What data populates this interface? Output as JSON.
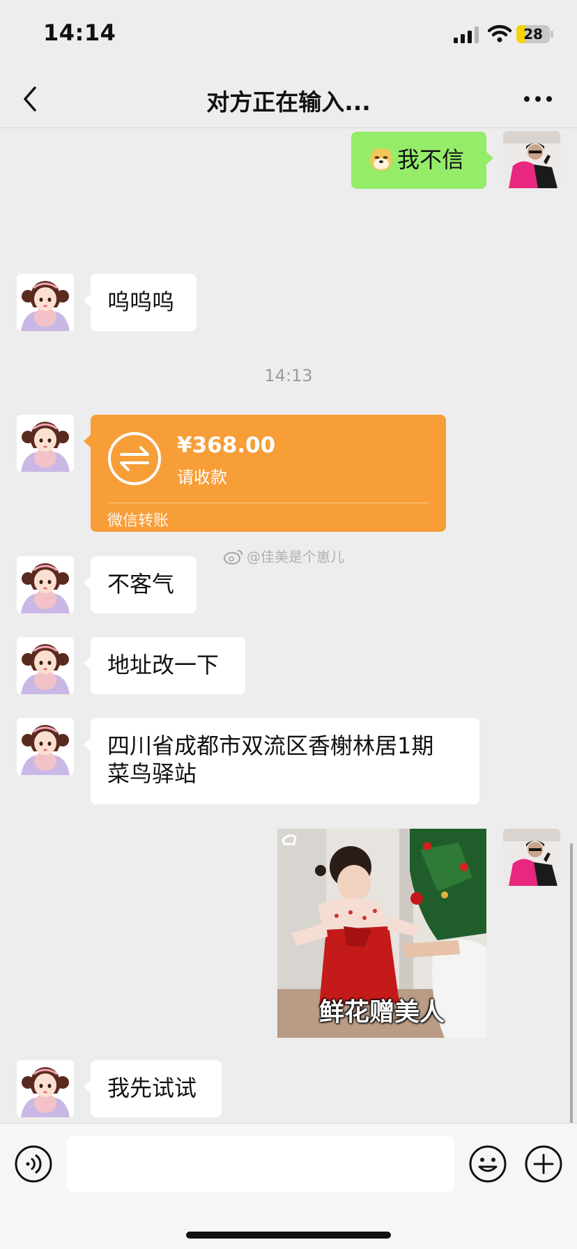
{
  "status_bar": {
    "time": "14:14",
    "battery_level": "28",
    "battery_fraction": 0.28,
    "battery_color": "#f5d20b"
  },
  "nav": {
    "title": "对方正在输入..."
  },
  "messages": [
    {
      "sender": "me",
      "type": "text",
      "emoji": "doge-emoji",
      "text": "我不信"
    },
    {
      "sender": "other",
      "type": "text",
      "text": "呜呜呜"
    },
    {
      "type": "timestamp",
      "text": "14:13"
    },
    {
      "sender": "other",
      "type": "transfer",
      "amount": "¥368.00",
      "note": "请收款",
      "label": "微信转账"
    },
    {
      "sender": "other",
      "type": "text",
      "text": "不客气"
    },
    {
      "sender": "other",
      "type": "text",
      "text": "地址改一下"
    },
    {
      "sender": "other",
      "type": "text",
      "lines": [
        "四川省成都市双流区香榭林居1期",
        "菜鸟驿站"
      ]
    },
    {
      "sender": "me",
      "type": "sticker",
      "caption": "鲜花赠美人"
    },
    {
      "sender": "other",
      "type": "text",
      "text": "我先试试"
    }
  ],
  "watermark": {
    "text": "@佳美是个崽儿"
  },
  "input_bar": {
    "value": "",
    "placeholder": ""
  },
  "colors": {
    "background": "#ededed",
    "my_bubble": "#95ec69",
    "other_bubble": "#ffffff",
    "transfer": "#f79e39"
  }
}
